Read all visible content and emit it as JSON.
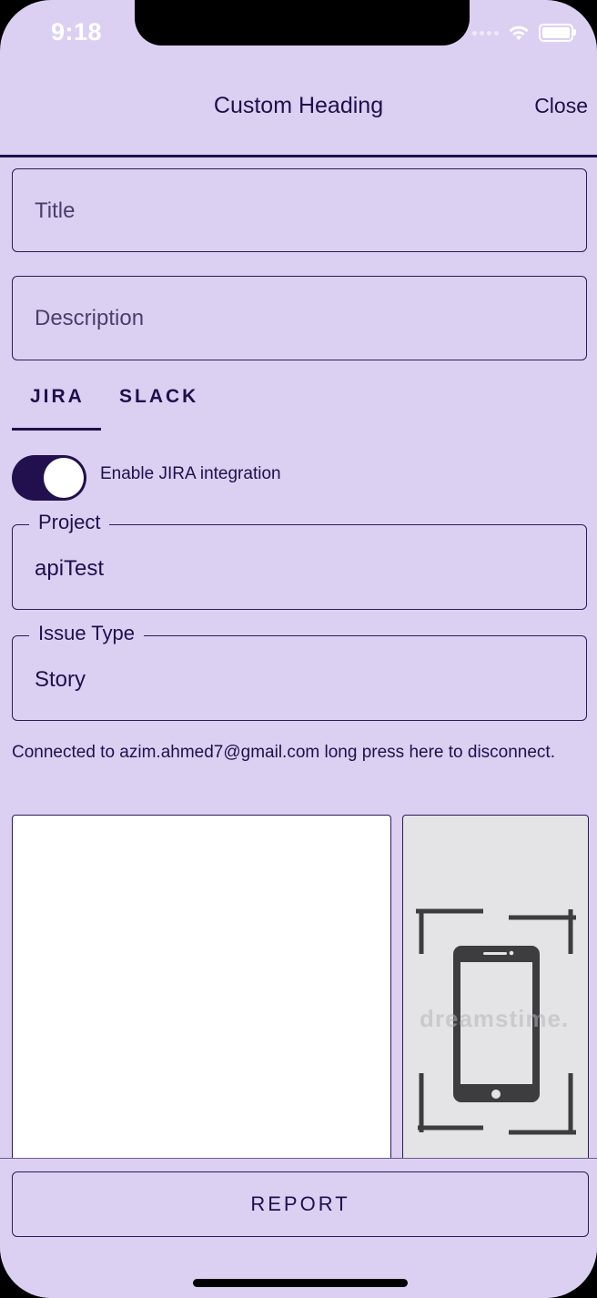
{
  "status_bar": {
    "time": "9:18"
  },
  "header": {
    "title": "Custom Heading",
    "close_label": "Close"
  },
  "form": {
    "title_placeholder": "Title",
    "description_placeholder": "Description"
  },
  "tabs": [
    {
      "label": "JIRA",
      "selected": true
    },
    {
      "label": "SLACK",
      "selected": false
    }
  ],
  "jira": {
    "toggle_label": "Enable JIRA integration",
    "toggle_on": true,
    "project_label": "Project",
    "project_value": "apiTest",
    "issue_type_label": "Issue Type",
    "issue_type_value": "Story",
    "connection_text": "Connected to azim.ahmed7@gmail.com long press here to disconnect."
  },
  "attachments": {
    "watermark": "dreamstime."
  },
  "footer": {
    "report_label": "REPORT"
  },
  "colors": {
    "background": "#dcd0f2",
    "primary": "#1f0f4d",
    "toggle": "#22104e"
  },
  "icons": [
    "wifi-icon",
    "battery-icon",
    "phone-screenshot-icon"
  ]
}
